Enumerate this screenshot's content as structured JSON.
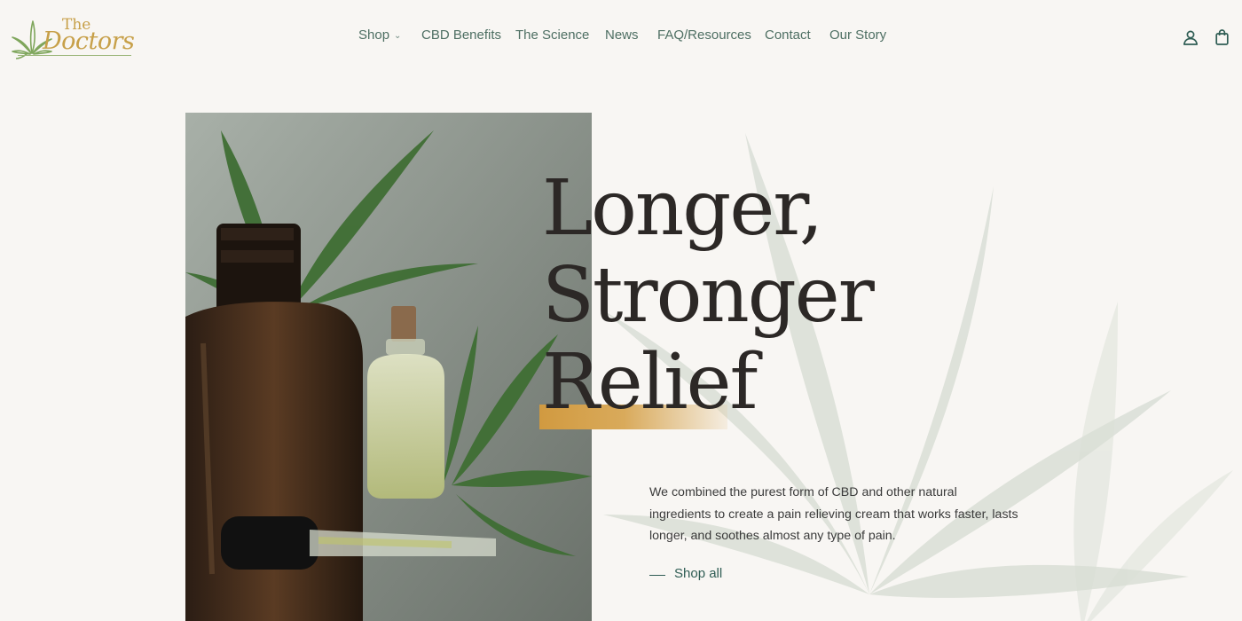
{
  "brand": {
    "line1": "The",
    "line2": "Doctors"
  },
  "nav": {
    "items": [
      {
        "label": "Shop",
        "has_dropdown": true
      },
      {
        "label": "CBD Benefits"
      },
      {
        "label": "The Science"
      },
      {
        "label": "News"
      },
      {
        "label": "FAQ/Resources"
      },
      {
        "label": "Contact"
      },
      {
        "label": "Our Story"
      }
    ]
  },
  "header_icons": [
    "account-icon",
    "shopping-bag-icon"
  ],
  "hero": {
    "title_lines": [
      "Longer,",
      "Stronger",
      "Relief"
    ],
    "description": "We combined the purest form of CBD and other natural ingredients to create a pain relieving cream that works faster, lasts longer, and soothes almost any type of pain.",
    "cta_label": "Shop all"
  },
  "colors": {
    "background": "#f8f6f3",
    "nav_text": "#4e6f63",
    "accent_gold": "#d19a40",
    "title_text": "#2c2826",
    "cta_text": "#2f5d54",
    "logo_gold": "#c7a049",
    "logo_green": "#7fa65c"
  }
}
